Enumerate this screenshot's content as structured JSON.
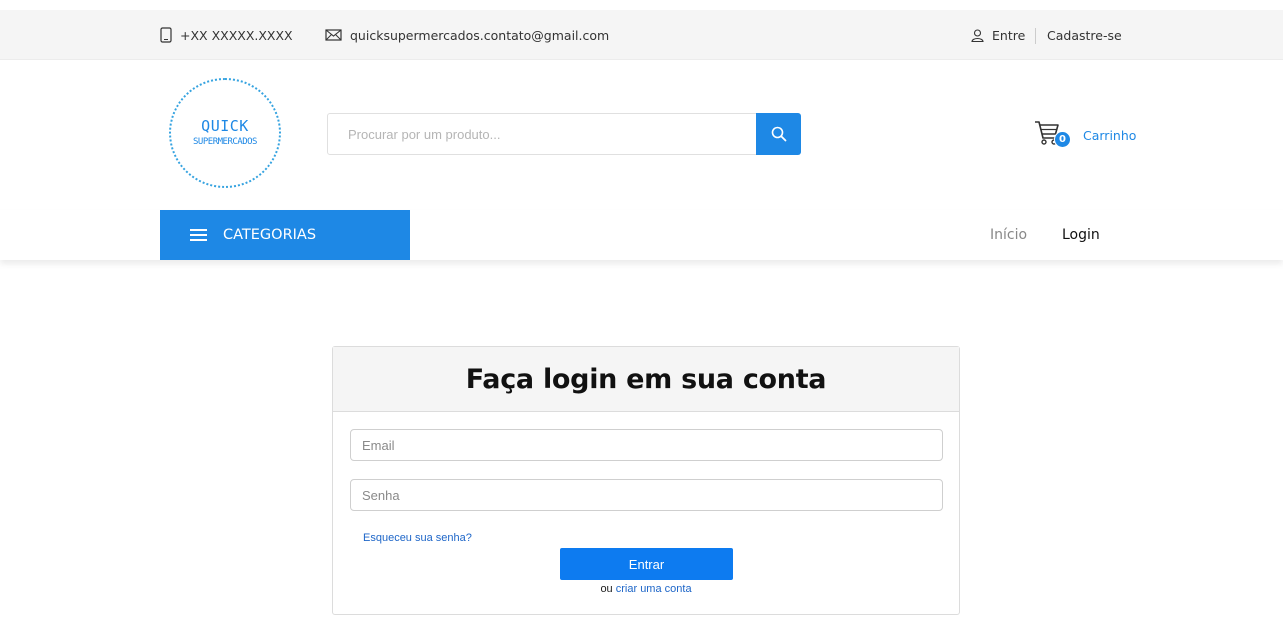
{
  "topbar": {
    "phone": "+XX XXXXX.XXXX",
    "email": "quicksupermercados.contato@gmail.com",
    "login_link": "Entre",
    "signup_link": "Cadastre-se"
  },
  "header": {
    "logo_line1": "QUICK",
    "logo_line2": "SUPERMERCADOS",
    "search_placeholder": "Procurar por um produto...",
    "cart_count": "0",
    "cart_label": "Carrinho"
  },
  "nav": {
    "categories_label": "CATEGORIAS",
    "links": [
      {
        "label": "Início"
      },
      {
        "label": "Login"
      }
    ]
  },
  "login_form": {
    "title": "Faça login em sua conta",
    "email_placeholder": "Email",
    "password_placeholder": "Senha",
    "forgot_link": "Esqueceu sua senha?",
    "submit_label": "Entrar",
    "alt_prefix": "ou",
    "create_account_link": "criar uma conta"
  },
  "colors": {
    "accent": "#1e88e5",
    "button": "#0d7bf0",
    "link": "#1e66c8",
    "topbar_bg": "#f5f5f5"
  },
  "icons": {
    "phone": "phone-icon",
    "mail": "mail-icon",
    "user": "user-icon",
    "search": "search-icon",
    "cart": "cart-icon",
    "menu": "menu-icon"
  }
}
